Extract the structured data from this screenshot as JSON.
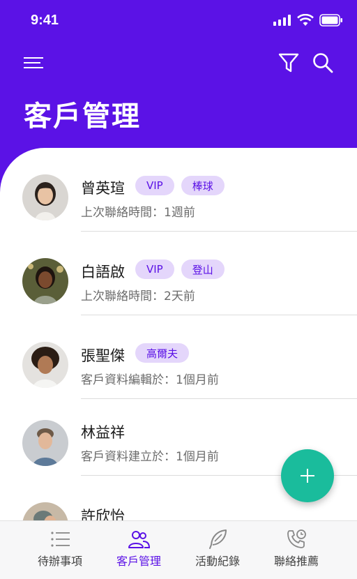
{
  "status_bar": {
    "time": "9:41"
  },
  "header": {
    "title": "客戶管理"
  },
  "customers": [
    {
      "name": "曾英瑄",
      "tags": [
        "VIP",
        "棒球"
      ],
      "subtitle": "上次聯絡時間：1週前"
    },
    {
      "name": "白語啟",
      "tags": [
        "VIP",
        "登山"
      ],
      "subtitle": "上次聯絡時間：2天前"
    },
    {
      "name": "張聖傑",
      "tags": [
        "高爾夫"
      ],
      "subtitle": "客戶資料編輯於：1個月前"
    },
    {
      "name": "林益祥",
      "tags": [],
      "subtitle": "客戶資料建立於：1個月前"
    },
    {
      "name": "許欣怡",
      "tags": [],
      "subtitle": ""
    }
  ],
  "tabs": [
    {
      "label": "待辦事項",
      "icon": "list-icon"
    },
    {
      "label": "客戶管理",
      "icon": "people-icon",
      "active": true
    },
    {
      "label": "活動紀錄",
      "icon": "feather-icon"
    },
    {
      "label": "聯絡推薦",
      "icon": "phone-clock-icon"
    }
  ],
  "colors": {
    "primary": "#5b12e6",
    "tag_bg": "#e4d6fb",
    "fab": "#1abc9c"
  }
}
